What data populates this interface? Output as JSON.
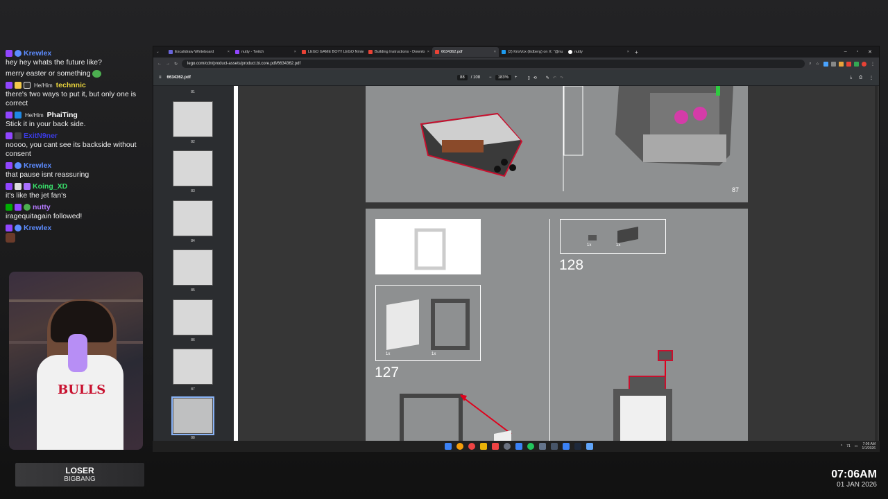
{
  "chat": [
    {
      "user": "Krewlex",
      "color": "#5d8cff",
      "pron": "",
      "text": "hey hey whats the future like?",
      "badges": [
        "sub",
        "circle"
      ]
    },
    {
      "user": "",
      "color": "",
      "pron": "",
      "text": "merry easter or something",
      "badges": [],
      "emote": true
    },
    {
      "user": "technnic",
      "color": "#e7d23c",
      "pron": "He/Him",
      "text": "there's two ways to put it, but only one is correct",
      "badges": [
        "sub",
        "star",
        "shield"
      ]
    },
    {
      "user": "PhaiTing",
      "color": "#ffffff",
      "pron": "He/Him",
      "text": "Stick it in your back side.",
      "badges": [
        "sub",
        "blue"
      ]
    },
    {
      "user": "ExitN9ner",
      "color": "#3a3ae0",
      "pron": "",
      "text": "noooo, you cant see its backside without consent",
      "badges": [
        "sub",
        "glyph"
      ]
    },
    {
      "user": "Krewlex",
      "color": "#5d8cff",
      "pron": "",
      "text": "that pause isnt reassuring",
      "badges": [
        "sub",
        "circle"
      ]
    },
    {
      "user": "Koing_XD",
      "color": "#39e06b",
      "pron": "",
      "text": "it's like the jet fan's",
      "badges": [
        "sub",
        "shield",
        "bits"
      ]
    },
    {
      "user": "nutty",
      "color": "#b57bff",
      "pron": "",
      "text": "iragequitagain followed!",
      "badges": [
        "green",
        "sub",
        "gear"
      ]
    },
    {
      "user": "Krewlex",
      "color": "#5d8cff",
      "pron": "",
      "text": "",
      "badges": [
        "sub",
        "circle"
      ],
      "emote2": true
    }
  ],
  "now_playing": {
    "title": "LOSER",
    "artist": "BIGBANG"
  },
  "clock": {
    "time": "07:06AM",
    "date": "01 JAN 2026"
  },
  "tabs": [
    {
      "label": "Excalidraw Whiteboard",
      "active": false
    },
    {
      "label": "nutty - Twitch",
      "active": false
    },
    {
      "label": "LEGO GAME BOY!! LEGO Ninte",
      "active": false
    },
    {
      "label": "Building Instructions - Downlo",
      "active": false
    },
    {
      "label": "6634362.pdf",
      "active": true
    },
    {
      "label": "(2) KrisVox (Edberg) on X: \"@nu",
      "active": false
    },
    {
      "label": "nutty",
      "active": false
    }
  ],
  "url": "lego.com/cdn/product-assets/product.bi.core.pdf/6634362.pdf",
  "pdf": {
    "filename": "6634362.pdf",
    "page": "88",
    "total": "/ 108",
    "zoom": "183%"
  },
  "thumbs": [
    "81",
    "82",
    "83",
    "84",
    "85",
    "86",
    "87",
    "88"
  ],
  "pages": {
    "top_page_number": "87",
    "step_a": "127",
    "step_b": "128",
    "qty": "1x"
  },
  "tray": {
    "time": "7:06 AM",
    "date": "1/1/2026",
    "num": "71"
  }
}
